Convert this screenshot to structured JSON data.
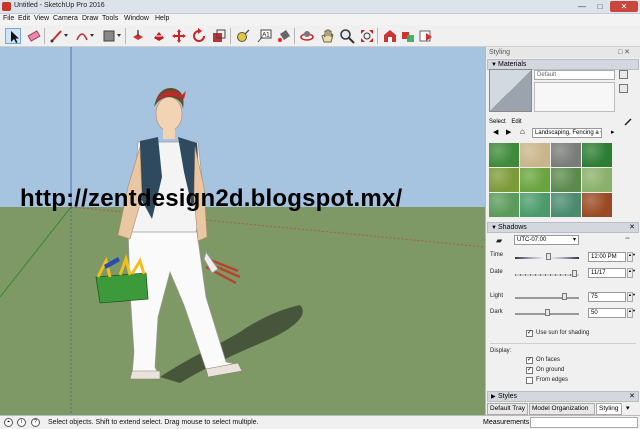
{
  "window": {
    "title": "Untitled - SketchUp Pro 2016",
    "minimize": "—",
    "maximize": "□",
    "close": "✕"
  },
  "menu": [
    "File",
    "Edit",
    "View",
    "Camera",
    "Draw",
    "Tools",
    "Window",
    "Help"
  ],
  "toolbar_icons": [
    "select-icon",
    "eraser-icon",
    "line-icon",
    "arc-icon",
    "shapes-icon",
    "pushpull-icon",
    "move-icon",
    "rotate-icon",
    "scale-icon",
    "tape-icon",
    "text-icon",
    "paint-bucket-icon",
    "orbit-icon",
    "pan-icon",
    "zoom-icon",
    "zoom-extents-icon",
    "warehouse-icon",
    "extension-icon"
  ],
  "viewport": {
    "watermark": "http://zentdesign2d.blogspot.mx/",
    "sky_color": "#a6c3df",
    "ground_color": "#7e9966"
  },
  "tray": {
    "title": "Styling",
    "pin": "□ ✕",
    "materials": {
      "header": "Materials",
      "name_value": "Default",
      "tabs": [
        "Select",
        "Edit"
      ],
      "library": "Landscaping, Fencing a",
      "thumb_colors": [
        "#3f8a3a",
        "#c9b58a",
        "#7a7c7a",
        "#2e7d34",
        "#7c9a3a",
        "#6aa43f",
        "#5c8a4d",
        "#8bb06b",
        "#5a9a5a",
        "#4a9a6a",
        "#4a8a6e",
        "#9a4a22"
      ]
    },
    "shadows": {
      "header": "Shadows",
      "timezone": "UTC-07:00",
      "time_label": "Time",
      "time_value": "12:00 PM",
      "date_label": "Date",
      "date_value": "11/17",
      "light_label": "Light",
      "light_value": "75",
      "light_fraction": 0.75,
      "dark_label": "Dark",
      "dark_value": "50",
      "dark_fraction": 0.5,
      "use_sun": "Use sun for shading",
      "display_label": "Display:",
      "on_faces": "On faces",
      "on_ground": "On ground",
      "from_edges": "From edges"
    },
    "styles_header": "Styles",
    "bottom_tabs": [
      "Default Tray",
      "Model Organization",
      "Styling"
    ]
  },
  "status": {
    "hint": "Select objects. Shift to extend select. Drag mouse to select multiple.",
    "measurements_label": "Measurements"
  }
}
